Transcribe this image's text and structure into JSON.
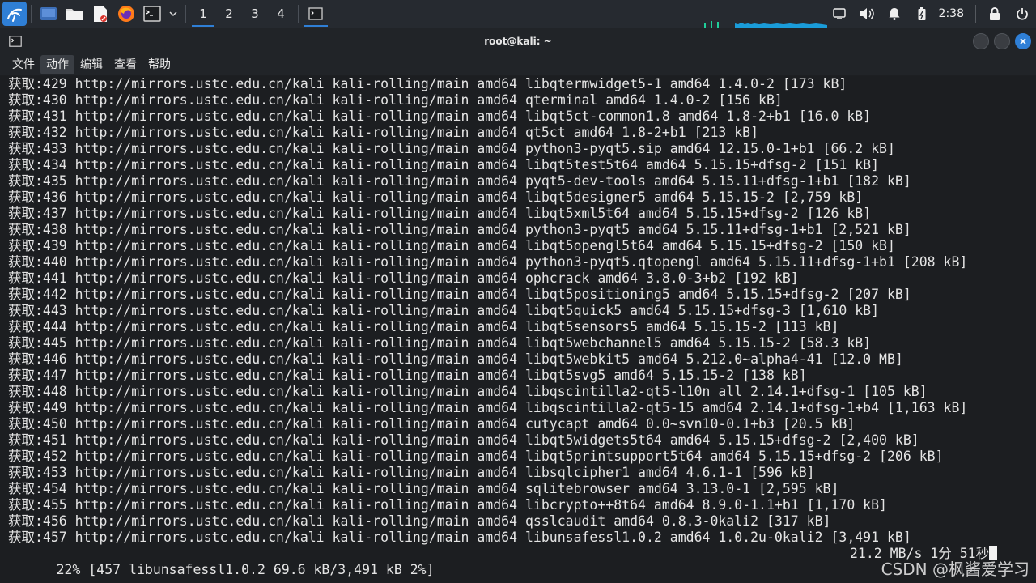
{
  "panel": {
    "workspaces": [
      "1",
      "2",
      "3",
      "4"
    ],
    "clock": "2:38",
    "icons": [
      "kali-menu-icon",
      "show-desktop-icon",
      "file-manager-icon",
      "text-editor-icon",
      "firefox-icon",
      "terminal-launcher-icon",
      "dropdown-chevron-icon"
    ]
  },
  "window": {
    "title": "root@kali: ~"
  },
  "menu": [
    "文件",
    "动作",
    "编辑",
    "查看",
    "帮助"
  ],
  "terminal": {
    "lines": [
      "获取:429 http://mirrors.ustc.edu.cn/kali kali-rolling/main amd64 libqtermwidget5-1 amd64 1.4.0-2 [173 kB]",
      "获取:430 http://mirrors.ustc.edu.cn/kali kali-rolling/main amd64 qterminal amd64 1.4.0-2 [156 kB]",
      "获取:431 http://mirrors.ustc.edu.cn/kali kali-rolling/main amd64 libqt5ct-common1.8 amd64 1.8-2+b1 [16.0 kB]",
      "获取:432 http://mirrors.ustc.edu.cn/kali kali-rolling/main amd64 qt5ct amd64 1.8-2+b1 [213 kB]",
      "获取:433 http://mirrors.ustc.edu.cn/kali kali-rolling/main amd64 python3-pyqt5.sip amd64 12.15.0-1+b1 [66.2 kB]",
      "获取:434 http://mirrors.ustc.edu.cn/kali kali-rolling/main amd64 libqt5test5t64 amd64 5.15.15+dfsg-2 [151 kB]",
      "获取:435 http://mirrors.ustc.edu.cn/kali kali-rolling/main amd64 pyqt5-dev-tools amd64 5.15.11+dfsg-1+b1 [182 kB]",
      "获取:436 http://mirrors.ustc.edu.cn/kali kali-rolling/main amd64 libqt5designer5 amd64 5.15.15-2 [2,759 kB]",
      "获取:437 http://mirrors.ustc.edu.cn/kali kali-rolling/main amd64 libqt5xml5t64 amd64 5.15.15+dfsg-2 [126 kB]",
      "获取:438 http://mirrors.ustc.edu.cn/kali kali-rolling/main amd64 python3-pyqt5 amd64 5.15.11+dfsg-1+b1 [2,521 kB]",
      "获取:439 http://mirrors.ustc.edu.cn/kali kali-rolling/main amd64 libqt5opengl5t64 amd64 5.15.15+dfsg-2 [150 kB]",
      "获取:440 http://mirrors.ustc.edu.cn/kali kali-rolling/main amd64 python3-pyqt5.qtopengl amd64 5.15.11+dfsg-1+b1 [208 kB]",
      "获取:441 http://mirrors.ustc.edu.cn/kali kali-rolling/main amd64 ophcrack amd64 3.8.0-3+b2 [192 kB]",
      "获取:442 http://mirrors.ustc.edu.cn/kali kali-rolling/main amd64 libqt5positioning5 amd64 5.15.15+dfsg-2 [207 kB]",
      "获取:443 http://mirrors.ustc.edu.cn/kali kali-rolling/main amd64 libqt5quick5 amd64 5.15.15+dfsg-3 [1,610 kB]",
      "获取:444 http://mirrors.ustc.edu.cn/kali kali-rolling/main amd64 libqt5sensors5 amd64 5.15.15-2 [113 kB]",
      "获取:445 http://mirrors.ustc.edu.cn/kali kali-rolling/main amd64 libqt5webchannel5 amd64 5.15.15-2 [58.3 kB]",
      "获取:446 http://mirrors.ustc.edu.cn/kali kali-rolling/main amd64 libqt5webkit5 amd64 5.212.0~alpha4-41 [12.0 MB]",
      "获取:447 http://mirrors.ustc.edu.cn/kali kali-rolling/main amd64 libqt5svg5 amd64 5.15.15-2 [138 kB]",
      "获取:448 http://mirrors.ustc.edu.cn/kali kali-rolling/main amd64 libqscintilla2-qt5-l10n all 2.14.1+dfsg-1 [105 kB]",
      "获取:449 http://mirrors.ustc.edu.cn/kali kali-rolling/main amd64 libqscintilla2-qt5-15 amd64 2.14.1+dfsg-1+b4 [1,163 kB]",
      "获取:450 http://mirrors.ustc.edu.cn/kali kali-rolling/main amd64 cutycapt amd64 0.0~svn10-0.1+b3 [20.5 kB]",
      "获取:451 http://mirrors.ustc.edu.cn/kali kali-rolling/main amd64 libqt5widgets5t64 amd64 5.15.15+dfsg-2 [2,400 kB]",
      "获取:452 http://mirrors.ustc.edu.cn/kali kali-rolling/main amd64 libqt5printsupport5t64 amd64 5.15.15+dfsg-2 [206 kB]",
      "获取:453 http://mirrors.ustc.edu.cn/kali kali-rolling/main amd64 libsqlcipher1 amd64 4.6.1-1 [596 kB]",
      "获取:454 http://mirrors.ustc.edu.cn/kali kali-rolling/main amd64 sqlitebrowser amd64 3.13.0-1 [2,595 kB]",
      "获取:455 http://mirrors.ustc.edu.cn/kali kali-rolling/main amd64 libcrypto++8t64 amd64 8.9.0-1.1+b1 [1,170 kB]",
      "获取:456 http://mirrors.ustc.edu.cn/kali kali-rolling/main amd64 qsslcaudit amd64 0.8.3-0kali2 [317 kB]",
      "获取:457 http://mirrors.ustc.edu.cn/kali kali-rolling/main amd64 libunsafessl1.0.2 amd64 1.0.2u-0kali2 [3,491 kB]"
    ],
    "status_left": "22% [457 libunsafessl1.0.2 69.6 kB/3,491 kB 2%]",
    "status_right": "21.2 MB/s 1分 51秒"
  },
  "watermark": "CSDN @枫酱爱学习",
  "colors": {
    "accent": "#2f7fd6",
    "terminal_bg": "#1c1e21",
    "terminal_fg": "#e4e4e4",
    "cpu_graph": "#1a9cd9"
  }
}
